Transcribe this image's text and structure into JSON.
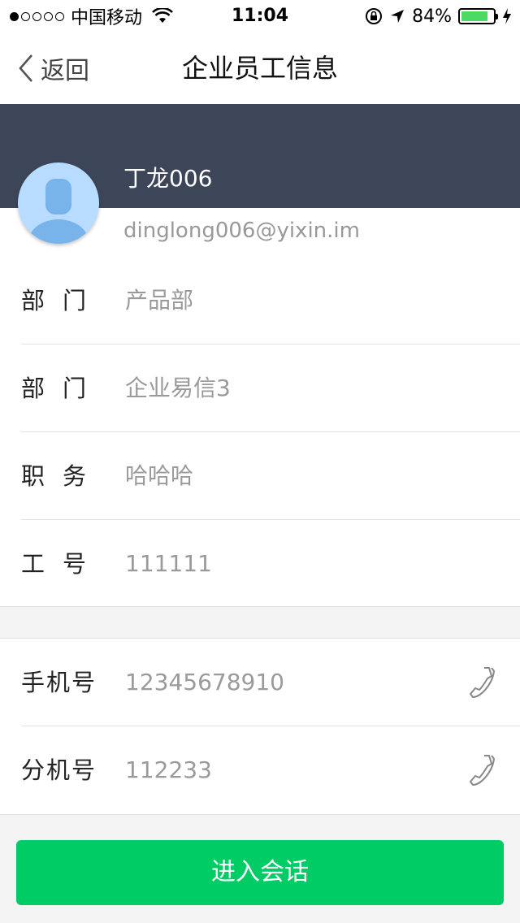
{
  "status_bar": {
    "carrier": "中国移动",
    "time": "11:04",
    "battery_percent": "84%",
    "battery_level": 0.84,
    "battery_color": "#4cd964"
  },
  "nav": {
    "back_label": "返回",
    "title": "企业员工信息"
  },
  "profile": {
    "name": "丁龙006",
    "email": "dinglong006@yixin.im",
    "header_color": "#3d4659"
  },
  "info_rows": [
    {
      "label": "部门",
      "value": "产品部"
    },
    {
      "label": "部门",
      "value": "企业易信3"
    },
    {
      "label": "职务",
      "value": "哈哈哈"
    },
    {
      "label": "工号",
      "value": "111111"
    }
  ],
  "contact_rows": [
    {
      "label": "手机号",
      "value": "12345678910",
      "icon": "phone-icon"
    },
    {
      "label": "分机号",
      "value": "112233",
      "icon": "phone-icon"
    }
  ],
  "action": {
    "chat_label": "进入会话",
    "color": "#00cc66"
  }
}
